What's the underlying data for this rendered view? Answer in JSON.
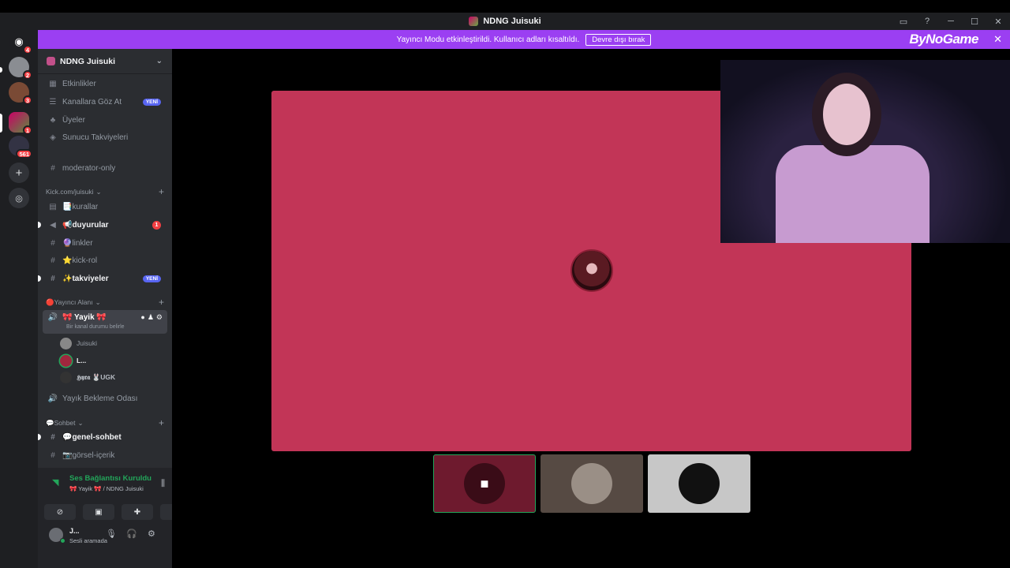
{
  "window": {
    "title": "NDNG Juisuki",
    "controls": [
      "minimize",
      "maximize",
      "close"
    ]
  },
  "banner": {
    "message": "Yayıncı Modu etkinleştirildi. Kullanıcı adları kısaltıldı.",
    "disable_label": "Devre dışı bırak",
    "logo": "ByNoGame",
    "color": "#9b3ff2"
  },
  "servers": [
    {
      "name": "discord-home",
      "badge": "4"
    },
    {
      "name": "server-1",
      "badge": "2"
    },
    {
      "name": "server-2",
      "badge": "3"
    },
    {
      "name": "server-3",
      "badge": "1"
    },
    {
      "name": "server-4",
      "badge": "561"
    }
  ],
  "guild": {
    "name": "NDNG Juisuki",
    "top_items": [
      {
        "label": "Etkinlikler",
        "icon": "calendar-icon"
      },
      {
        "label": "Kanallara Göz At",
        "icon": "browse-icon",
        "badge": "YENİ"
      },
      {
        "label": "Üyeler",
        "icon": "members-icon"
      },
      {
        "label": "Sunucu Takviyeleri",
        "icon": "boost-icon"
      }
    ],
    "moderator_channel": "moderator-only",
    "categories": [
      {
        "name": "Kick.com/juisuki",
        "channels": [
          {
            "label": "📑kurallar"
          },
          {
            "label": "📢duyurular",
            "badge": "1",
            "bright": true
          },
          {
            "label": "🔮linkler"
          },
          {
            "label": "⭐kick-rol"
          },
          {
            "label": "✨takviyeler",
            "badge": "YENİ",
            "bright": true
          }
        ]
      },
      {
        "name": "🔴Yayıncı Alanı",
        "voice_channel": {
          "label": "🎀 Yayik 🎀",
          "status": "Bir kanal durumu belirle"
        },
        "members": [
          "Juisuki",
          "L...",
          "𝕳𝖞𝖗𝖆 🐰UGK"
        ],
        "waiting_room": "Yayık Bekleme Odası"
      },
      {
        "name": "💬Sohbet",
        "channels": [
          {
            "label": "💬genel-sohbet",
            "bright": true
          },
          {
            "label": "📷görsel-içerik"
          }
        ]
      }
    ]
  },
  "voice_panel": {
    "title": "Ses Bağlantısı Kuruldu",
    "subtitle": "🎀 Yayik 🎀 / NDNG Juisuki",
    "actions": [
      "camera-off-icon",
      "screen-share-icon",
      "activities-icon",
      "soundboard-icon"
    ]
  },
  "user": {
    "name": "J...",
    "status": "Sesli aramada"
  },
  "stage": {
    "main_tile_color": "#c23557",
    "thumbnails": [
      "camera",
      "avatar",
      "avatar"
    ]
  }
}
